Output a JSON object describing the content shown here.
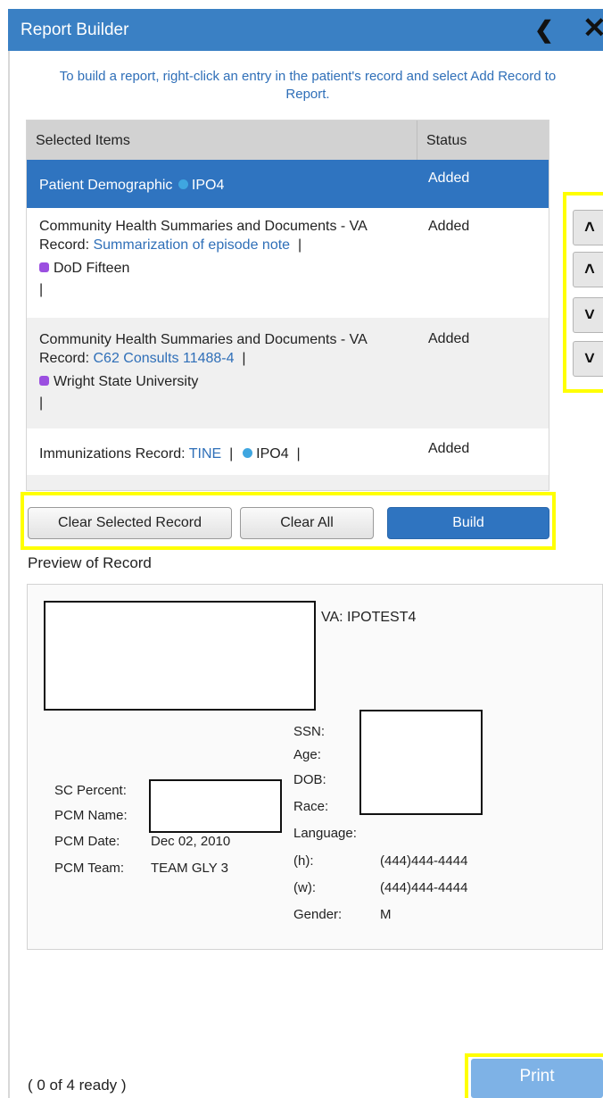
{
  "panel": {
    "title": "Report Builder"
  },
  "instructions": "To build a report, right-click an entry in the patient's record and select Add Record to Report.",
  "table": {
    "headers": {
      "items": "Selected Items",
      "status": "Status"
    },
    "rows": [
      {
        "text": "Patient Demographic",
        "facility": "IPO4",
        "status": "Added"
      },
      {
        "line1": "Community Health Summaries and Documents - VA",
        "record_label": "Record:",
        "record_link": "Summarization of episode note",
        "sep": "|",
        "facility": "DoD Fifteen",
        "pipe": "|",
        "status": "Added"
      },
      {
        "line1": "Community Health Summaries and Documents - VA",
        "record_label": "Record:",
        "record_link": "C62 Consults 11488-4",
        "sep": "|",
        "facility": "Wright State University",
        "pipe": "|",
        "status": "Added"
      },
      {
        "record_label": "Immunizations Record:",
        "record_link": "TINE",
        "sep": "|",
        "facility": "IPO4",
        "sep2": "|",
        "status": "Added"
      }
    ]
  },
  "reorder": {
    "top_icon": "double-chevron-up-icon",
    "up_icon": "chevron-up-icon",
    "down_icon": "chevron-down-icon",
    "bottom_icon": "double-chevron-down-icon"
  },
  "buttons": {
    "clear_selected": "Clear Selected Record",
    "clear_all": "Clear All",
    "build": "Build"
  },
  "preview": {
    "label": "Preview of Record",
    "va_id": "VA: IPOTEST4",
    "ssn_label": "SSN:",
    "age_label": "Age:",
    "dob_label": "DOB:",
    "race_label": "Race:",
    "language_label": "Language:",
    "home_label": "(h):",
    "home_phone": "(444)444-4444",
    "work_label": "(w):",
    "work_phone": "(444)444-4444",
    "gender_label": "Gender:",
    "gender_value": "M",
    "sc_percent_label": "SC Percent:",
    "pcm_name_label": "PCM Name:",
    "pcm_date_label": "PCM Date:",
    "pcm_date_value": "Dec 02, 2010",
    "pcm_team_label": "PCM Team:",
    "pcm_team_value": "TEAM GLY 3"
  },
  "footer": {
    "status": "( 0 of 4 ready )",
    "print": "Print"
  },
  "colors": {
    "header": "#3a80c4",
    "selected_row": "#2f74c0",
    "link": "#2f6fb8",
    "highlight": "#ffff00",
    "print_disabled": "#7eb2e6"
  }
}
